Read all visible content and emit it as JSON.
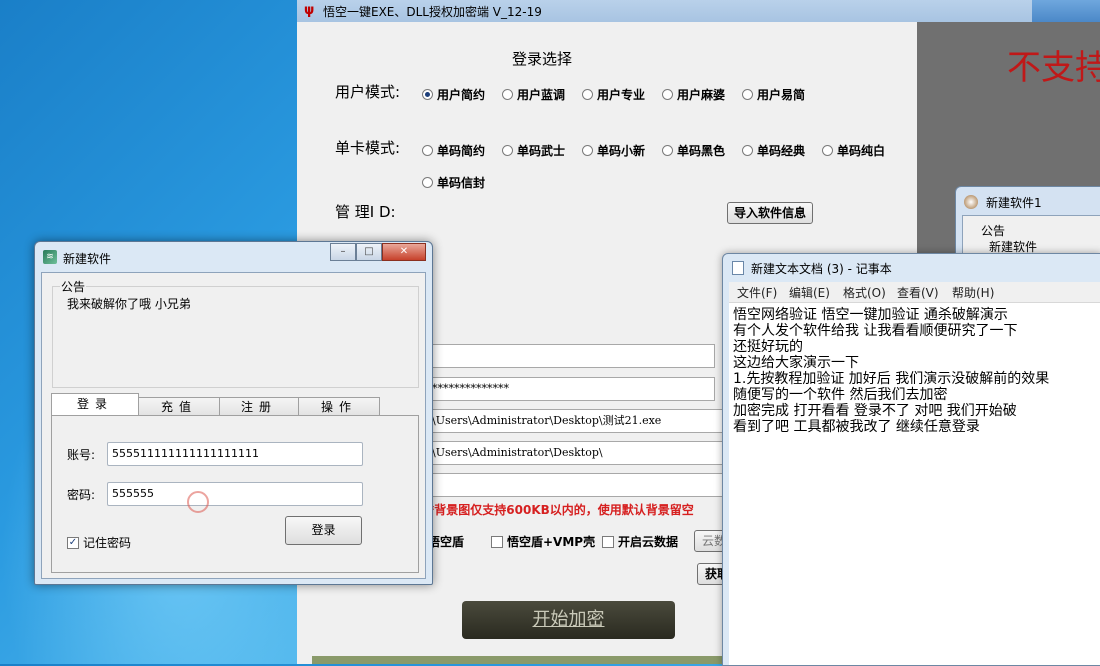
{
  "main_window": {
    "title": "悟空一键EXE、DLL授权加密端 V_12-19",
    "heading": "登录选择",
    "user_mode_label": "用户模式:",
    "user_modes": [
      "用户简约",
      "用户蓝调",
      "用户专业",
      "用户麻婆",
      "用户易简"
    ],
    "card_mode_label": "单卡模式:",
    "card_modes": [
      "单码简约",
      "单码武士",
      "单码小新",
      "单码黑色",
      "单码经典",
      "单码纯白",
      "单码信封"
    ],
    "admin_id_label": "管 理I D:",
    "import_button": "导入软件信息",
    "password_mask": "**************",
    "path_exe": "\\Users\\Administrator\\Desktop\\测试21.exe",
    "path_dir": "\\Users\\Administrator\\Desktop\\",
    "warning": "*背景图仅支持600KB以内的，使用默认背景留空",
    "options": [
      "悟空盾",
      "悟空盾+VMP壳",
      "开启云数据"
    ],
    "cloud_button": "云数",
    "get_button": "获取",
    "start_button": "开始加密",
    "side_banner": "不支持"
  },
  "login_dialog": {
    "title": "新建软件",
    "notice_label": "公告",
    "notice_text": "我来破解你了哦  小兄弟",
    "tabs": [
      "登录",
      "充值",
      "注册",
      "操作"
    ],
    "account_label": "账号:",
    "account_value": "555511111111111111111",
    "password_label": "密码:",
    "password_value": "555555",
    "remember_label": "记住密码",
    "login_button": "登录",
    "caption_buttons": [
      "–",
      "□",
      "✕"
    ]
  },
  "window2": {
    "title": "新建软件1",
    "notice_label": "公告",
    "notice_text": "新建软件"
  },
  "notepad": {
    "title": "新建文本文档 (3) - 记事本",
    "menu": [
      "文件(F)",
      "编辑(E)",
      "格式(O)",
      "查看(V)",
      "帮助(H)"
    ],
    "lines": [
      "悟空网络验证  悟空一键加验证 通杀破解演示",
      "有个人发个软件给我 让我看看顺便研究了一下",
      "还挺好玩的",
      "这边给大家演示一下",
      "1.先按教程加验证  加好后 我们演示没破解前的效果",
      "随便写的一个软件 然后我们去加密",
      "加密完成 打开看看    登录不了   对吧 我们开始破",
      "看到了吧 工具都被我改了    继续任意登录"
    ]
  }
}
